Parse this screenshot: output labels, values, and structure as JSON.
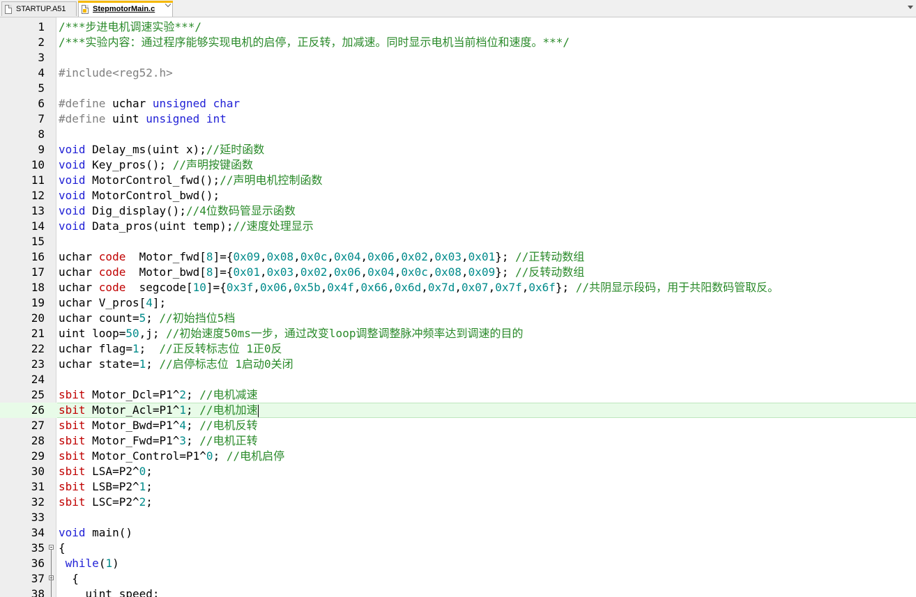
{
  "tabs": [
    {
      "label": "STARTUP.A51",
      "active": false
    },
    {
      "label": "StepmotorMain.c",
      "active": true
    }
  ],
  "editor": {
    "current_line": 26,
    "lines": [
      {
        "n": "1",
        "tokens": [
          [
            "cm",
            "/***步进电机调速实验***/"
          ]
        ]
      },
      {
        "n": "2",
        "tokens": [
          [
            "cm",
            "/***实验内容：通过程序能够实现电机的启停，正反转，加减速。同时显示电机当前档位和速度。***/"
          ]
        ]
      },
      {
        "n": "3",
        "tokens": []
      },
      {
        "n": "4",
        "tokens": [
          [
            "pp",
            "#include<reg52.h>"
          ]
        ]
      },
      {
        "n": "5",
        "tokens": []
      },
      {
        "n": "6",
        "tokens": [
          [
            "pp",
            "#define"
          ],
          [
            "t",
            " uchar "
          ],
          [
            "ty",
            "unsigned char"
          ]
        ]
      },
      {
        "n": "7",
        "tokens": [
          [
            "pp",
            "#define"
          ],
          [
            "t",
            " uint "
          ],
          [
            "ty",
            "unsigned int"
          ]
        ]
      },
      {
        "n": "8",
        "tokens": []
      },
      {
        "n": "9",
        "tokens": [
          [
            "kw",
            "void"
          ],
          [
            "t",
            " Delay_ms(uint x);"
          ],
          [
            "cm",
            "//延时函数"
          ]
        ]
      },
      {
        "n": "10",
        "tokens": [
          [
            "kw",
            "void"
          ],
          [
            "t",
            " Key_pros(); "
          ],
          [
            "cm",
            "//声明按键函数"
          ]
        ]
      },
      {
        "n": "11",
        "tokens": [
          [
            "kw",
            "void"
          ],
          [
            "t",
            " MotorControl_fwd();"
          ],
          [
            "cm",
            "//声明电机控制函数"
          ]
        ]
      },
      {
        "n": "12",
        "tokens": [
          [
            "kw",
            "void"
          ],
          [
            "t",
            " MotorControl_bwd();"
          ]
        ]
      },
      {
        "n": "13",
        "tokens": [
          [
            "kw",
            "void"
          ],
          [
            "t",
            " Dig_display();"
          ],
          [
            "cm",
            "//4位数码管显示函数"
          ]
        ]
      },
      {
        "n": "14",
        "tokens": [
          [
            "kw",
            "void"
          ],
          [
            "t",
            " Data_pros(uint temp);"
          ],
          [
            "cm",
            "//速度处理显示"
          ]
        ]
      },
      {
        "n": "15",
        "tokens": []
      },
      {
        "n": "16",
        "tokens": [
          [
            "t",
            "uchar "
          ],
          [
            "sb",
            "code"
          ],
          [
            "t",
            "  Motor_fwd["
          ],
          [
            "num",
            "8"
          ],
          [
            "t",
            "]={"
          ],
          [
            "num",
            "0x09"
          ],
          [
            "t",
            ","
          ],
          [
            "num",
            "0x08"
          ],
          [
            "t",
            ","
          ],
          [
            "num",
            "0x0c"
          ],
          [
            "t",
            ","
          ],
          [
            "num",
            "0x04"
          ],
          [
            "t",
            ","
          ],
          [
            "num",
            "0x06"
          ],
          [
            "t",
            ","
          ],
          [
            "num",
            "0x02"
          ],
          [
            "t",
            ","
          ],
          [
            "num",
            "0x03"
          ],
          [
            "t",
            ","
          ],
          [
            "num",
            "0x01"
          ],
          [
            "t",
            "}; "
          ],
          [
            "cm",
            "//正转动数组"
          ]
        ]
      },
      {
        "n": "17",
        "tokens": [
          [
            "t",
            "uchar "
          ],
          [
            "sb",
            "code"
          ],
          [
            "t",
            "  Motor_bwd["
          ],
          [
            "num",
            "8"
          ],
          [
            "t",
            "]={"
          ],
          [
            "num",
            "0x01"
          ],
          [
            "t",
            ","
          ],
          [
            "num",
            "0x03"
          ],
          [
            "t",
            ","
          ],
          [
            "num",
            "0x02"
          ],
          [
            "t",
            ","
          ],
          [
            "num",
            "0x06"
          ],
          [
            "t",
            ","
          ],
          [
            "num",
            "0x04"
          ],
          [
            "t",
            ","
          ],
          [
            "num",
            "0x0c"
          ],
          [
            "t",
            ","
          ],
          [
            "num",
            "0x08"
          ],
          [
            "t",
            ","
          ],
          [
            "num",
            "0x09"
          ],
          [
            "t",
            "}; "
          ],
          [
            "cm",
            "//反转动数组"
          ]
        ]
      },
      {
        "n": "18",
        "tokens": [
          [
            "t",
            "uchar "
          ],
          [
            "sb",
            "code"
          ],
          [
            "t",
            "  segcode["
          ],
          [
            "num",
            "10"
          ],
          [
            "t",
            "]={"
          ],
          [
            "num",
            "0x3f"
          ],
          [
            "t",
            ","
          ],
          [
            "num",
            "0x06"
          ],
          [
            "t",
            ","
          ],
          [
            "num",
            "0x5b"
          ],
          [
            "t",
            ","
          ],
          [
            "num",
            "0x4f"
          ],
          [
            "t",
            ","
          ],
          [
            "num",
            "0x66"
          ],
          [
            "t",
            ","
          ],
          [
            "num",
            "0x6d"
          ],
          [
            "t",
            ","
          ],
          [
            "num",
            "0x7d"
          ],
          [
            "t",
            ","
          ],
          [
            "num",
            "0x07"
          ],
          [
            "t",
            ","
          ],
          [
            "num",
            "0x7f"
          ],
          [
            "t",
            ","
          ],
          [
            "num",
            "0x6f"
          ],
          [
            "t",
            "}; "
          ],
          [
            "cm",
            "//共阴显示段码，用于共阳数码管取反。"
          ]
        ]
      },
      {
        "n": "19",
        "tokens": [
          [
            "t",
            "uchar V_pros["
          ],
          [
            "num",
            "4"
          ],
          [
            "t",
            "];"
          ]
        ]
      },
      {
        "n": "20",
        "tokens": [
          [
            "t",
            "uchar count="
          ],
          [
            "num",
            "5"
          ],
          [
            "t",
            "; "
          ],
          [
            "cm",
            "//初始挡位5档"
          ]
        ]
      },
      {
        "n": "21",
        "tokens": [
          [
            "t",
            "uint loop="
          ],
          [
            "num",
            "50"
          ],
          [
            "t",
            ",j; "
          ],
          [
            "cm",
            "//初始速度50ms一步，通过改变loop调整调整脉冲频率达到调速的目的"
          ]
        ]
      },
      {
        "n": "22",
        "tokens": [
          [
            "t",
            "uchar flag="
          ],
          [
            "num",
            "1"
          ],
          [
            "t",
            ";  "
          ],
          [
            "cm",
            "//正反转标志位 1正0反"
          ]
        ]
      },
      {
        "n": "23",
        "tokens": [
          [
            "t",
            "uchar state="
          ],
          [
            "num",
            "1"
          ],
          [
            "t",
            "; "
          ],
          [
            "cm",
            "//启停标志位 1启动0关闭"
          ]
        ]
      },
      {
        "n": "24",
        "tokens": []
      },
      {
        "n": "25",
        "tokens": [
          [
            "sb",
            "sbit"
          ],
          [
            "t",
            " Motor_Dcl=P1^"
          ],
          [
            "num",
            "2"
          ],
          [
            "t",
            "; "
          ],
          [
            "cm",
            "//电机减速"
          ]
        ]
      },
      {
        "n": "26",
        "tokens": [
          [
            "sb",
            "sbit"
          ],
          [
            "t",
            " Motor_Acl=P1^"
          ],
          [
            "num",
            "1"
          ],
          [
            "t",
            "; "
          ],
          [
            "cm",
            "//电机加速"
          ],
          [
            "caret",
            ""
          ]
        ]
      },
      {
        "n": "27",
        "tokens": [
          [
            "sb",
            "sbit"
          ],
          [
            "t",
            " Motor_Bwd=P1^"
          ],
          [
            "num",
            "4"
          ],
          [
            "t",
            "; "
          ],
          [
            "cm",
            "//电机反转"
          ]
        ]
      },
      {
        "n": "28",
        "tokens": [
          [
            "sb",
            "sbit"
          ],
          [
            "t",
            " Motor_Fwd=P1^"
          ],
          [
            "num",
            "3"
          ],
          [
            "t",
            "; "
          ],
          [
            "cm",
            "//电机正转"
          ]
        ]
      },
      {
        "n": "29",
        "tokens": [
          [
            "sb",
            "sbit"
          ],
          [
            "t",
            " Motor_Control=P1^"
          ],
          [
            "num",
            "0"
          ],
          [
            "t",
            "; "
          ],
          [
            "cm",
            "//电机启停"
          ]
        ]
      },
      {
        "n": "30",
        "tokens": [
          [
            "sb",
            "sbit"
          ],
          [
            "t",
            " LSA=P2^"
          ],
          [
            "num",
            "0"
          ],
          [
            "t",
            ";"
          ]
        ]
      },
      {
        "n": "31",
        "tokens": [
          [
            "sb",
            "sbit"
          ],
          [
            "t",
            " LSB=P2^"
          ],
          [
            "num",
            "1"
          ],
          [
            "t",
            ";"
          ]
        ]
      },
      {
        "n": "32",
        "tokens": [
          [
            "sb",
            "sbit"
          ],
          [
            "t",
            " LSC=P2^"
          ],
          [
            "num",
            "2"
          ],
          [
            "t",
            ";"
          ]
        ]
      },
      {
        "n": "33",
        "tokens": []
      },
      {
        "n": "34",
        "tokens": [
          [
            "kw",
            "void"
          ],
          [
            "t",
            " main()"
          ]
        ]
      },
      {
        "n": "35",
        "fold": true,
        "tokens": [
          [
            "t",
            "{"
          ]
        ]
      },
      {
        "n": "36",
        "tokens": [
          [
            "t",
            " "
          ],
          [
            "kw",
            "while"
          ],
          [
            "t",
            "("
          ],
          [
            "num",
            "1"
          ],
          [
            "t",
            ")"
          ]
        ]
      },
      {
        "n": "37",
        "fold": true,
        "tokens": [
          [
            "t",
            "  {"
          ]
        ]
      },
      {
        "n": "38",
        "tokens": [
          [
            "t",
            "    uint speed;"
          ]
        ]
      }
    ]
  }
}
